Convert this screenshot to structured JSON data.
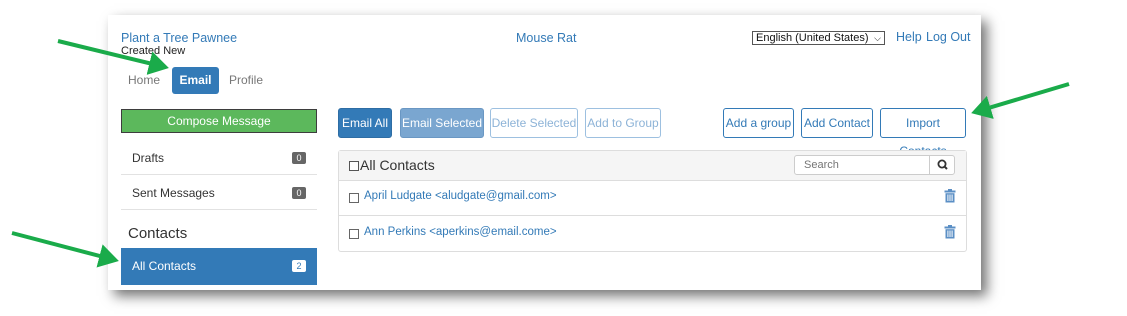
{
  "header": {
    "org_name": "Plant a Tree Pawnee",
    "created_label": "Created New",
    "center_title": "Mouse Rat",
    "language_selected": "English (United States)",
    "help_label": "Help",
    "logout_label": "Log Out"
  },
  "tabs": [
    {
      "label": "Home",
      "active": false
    },
    {
      "label": "Email",
      "active": true
    },
    {
      "label": "Profile",
      "active": false
    }
  ],
  "sidebar": {
    "compose_label": "Compose Message",
    "items": [
      {
        "label": "Drafts",
        "count": "0"
      },
      {
        "label": "Sent Messages",
        "count": "0"
      }
    ],
    "contacts_heading": "Contacts",
    "all_contacts": {
      "label": "All Contacts",
      "count": "2"
    }
  },
  "toolbar": {
    "email_all": "Email All",
    "email_selected": "Email Selected",
    "delete_selected": "Delete Selected",
    "add_to_group": "Add to Group",
    "add_group": "Add a group",
    "add_contact": "Add Contact",
    "import_contacts": "Import Contacts"
  },
  "contacts_panel": {
    "title": "All Contacts",
    "search_placeholder": "Search",
    "rows": [
      {
        "text": "April Ludgate <aludgate@gmail.com>"
      },
      {
        "text": "Ann Perkins <aperkins@email.come>"
      }
    ]
  },
  "colors": {
    "primary": "#337ab7",
    "compose_green": "#5cb85c",
    "annotation_arrow": "#1aab4a"
  },
  "icons": [
    "chevron-down-icon",
    "search-icon",
    "trash-icon",
    "annotation-arrow-icon"
  ]
}
